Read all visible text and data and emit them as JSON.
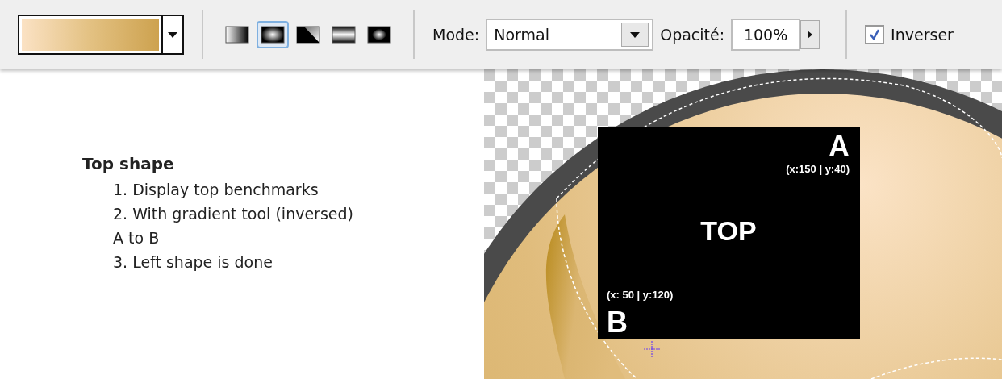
{
  "toolbar": {
    "gradient_types": [
      {
        "kind": "linear",
        "selected": false
      },
      {
        "kind": "radial",
        "selected": true
      },
      {
        "kind": "angle",
        "selected": false
      },
      {
        "kind": "reflected",
        "selected": false
      },
      {
        "kind": "diamond",
        "selected": false
      }
    ],
    "mode": {
      "label": "Mode:",
      "value": "Normal"
    },
    "opacity": {
      "label": "Opacité:",
      "value": "100%"
    },
    "reverse": {
      "label": "Inverser",
      "checked": true
    }
  },
  "instructions": {
    "title": "Top shape",
    "steps": [
      "1. Display top benchmarks",
      "2. With gradient tool (inversed)",
      "A to B",
      "3. Left shape is done"
    ]
  },
  "canvas": {
    "center_label": "TOP",
    "point_a": {
      "letter": "A",
      "coords": "(x:150 | y:40)"
    },
    "point_b": {
      "letter": "B",
      "coords": "(x: 50 | y:120)"
    }
  }
}
